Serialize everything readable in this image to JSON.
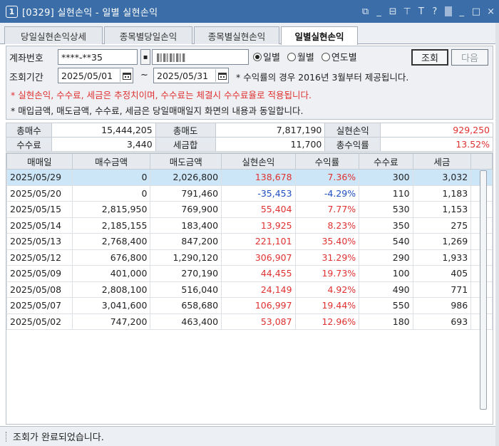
{
  "window": {
    "number": "1",
    "title": "[0329] 실현손익 - 일별 실현손익",
    "controls": [
      "⧉",
      "_",
      "⊟",
      "⊤",
      "T",
      "?",
      "_",
      "□",
      "×"
    ]
  },
  "tabs": [
    {
      "label": "당일실현손익상세"
    },
    {
      "label": "종목별당일손익"
    },
    {
      "label": "종목별실현손익"
    },
    {
      "label": "일별실현손익"
    }
  ],
  "form": {
    "account_label": "계좌번호",
    "account_value": "****-**35",
    "period_label": "조회기간",
    "start_date": "2025/05/01",
    "end_date": "2025/05/31",
    "tilde": "~",
    "radios": [
      {
        "label": "일별",
        "checked": true
      },
      {
        "label": "월별",
        "checked": false
      },
      {
        "label": "연도별",
        "checked": false
      }
    ],
    "search_button": "조회",
    "next_button": "다음",
    "note_return": "* 수익률의 경우 2016년 3월부터 제공됩니다.",
    "note_red": "* 실현손익, 수수료, 세금은 추정치이며, 수수료는 체결시 수수료율로 적용됩니다.",
    "note_black": "* 매입금액, 매도금액, 수수료, 세금은 당일매매일지 화면의 내용과 동일합니다."
  },
  "summary": {
    "total_buy_label": "총매수",
    "total_buy": "15,444,205",
    "total_sell_label": "총매도",
    "total_sell": "7,817,190",
    "realized_label": "실현손익",
    "realized": "929,250",
    "fee_label": "수수료",
    "fee": "3,440",
    "tax_label": "세금합",
    "tax": "11,700",
    "return_label": "총수익률",
    "return": "13.52%"
  },
  "table": {
    "headers": [
      "매매일",
      "매수금액",
      "매도금액",
      "실현손익",
      "수익률",
      "수수료",
      "세금"
    ],
    "rows": [
      {
        "date": "2025/05/29",
        "buy": "0",
        "sell": "2,026,800",
        "pl": "138,678",
        "ret": "7.36%",
        "fee": "300",
        "tax": "3,032"
      },
      {
        "date": "2025/05/20",
        "buy": "0",
        "sell": "791,460",
        "pl": "-35,453",
        "ret": "-4.29%",
        "fee": "110",
        "tax": "1,183"
      },
      {
        "date": "2025/05/15",
        "buy": "2,815,950",
        "sell": "769,900",
        "pl": "55,404",
        "ret": "7.77%",
        "fee": "530",
        "tax": "1,153"
      },
      {
        "date": "2025/05/14",
        "buy": "2,185,155",
        "sell": "183,400",
        "pl": "13,925",
        "ret": "8.23%",
        "fee": "350",
        "tax": "275"
      },
      {
        "date": "2025/05/13",
        "buy": "2,768,400",
        "sell": "847,200",
        "pl": "221,101",
        "ret": "35.40%",
        "fee": "540",
        "tax": "1,269"
      },
      {
        "date": "2025/05/12",
        "buy": "676,800",
        "sell": "1,290,120",
        "pl": "306,907",
        "ret": "31.29%",
        "fee": "290",
        "tax": "1,933"
      },
      {
        "date": "2025/05/09",
        "buy": "401,000",
        "sell": "270,190",
        "pl": "44,455",
        "ret": "19.73%",
        "fee": "100",
        "tax": "405"
      },
      {
        "date": "2025/05/08",
        "buy": "2,808,100",
        "sell": "516,040",
        "pl": "24,149",
        "ret": "4.92%",
        "fee": "490",
        "tax": "771"
      },
      {
        "date": "2025/05/07",
        "buy": "3,041,600",
        "sell": "658,680",
        "pl": "106,997",
        "ret": "19.44%",
        "fee": "550",
        "tax": "986"
      },
      {
        "date": "2025/05/02",
        "buy": "747,200",
        "sell": "463,400",
        "pl": "53,087",
        "ret": "12.96%",
        "fee": "180",
        "tax": "693"
      }
    ]
  },
  "status": {
    "text": "조회가 완료되었습니다."
  },
  "colors": {
    "titlebar": "#3b6ea8",
    "positive": "#e03131",
    "negative": "#1f4fbf",
    "selected_row": "#cde6f7"
  }
}
